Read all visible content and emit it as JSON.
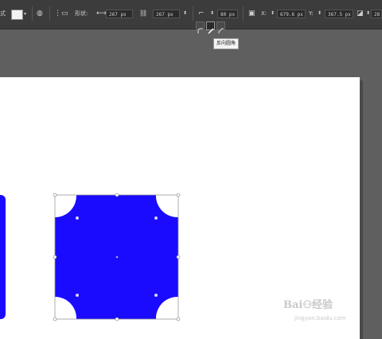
{
  "toolbar": {
    "shape_label": "形状:",
    "width_icon": "⟷",
    "width_value": "267 px",
    "link_icon": "🔗",
    "height_value": "267 px",
    "radius_icon": "⌐",
    "radius_value": "80 px",
    "x_value": "679.6 px",
    "y_value": "367.5 px",
    "x_label": "X:",
    "y_label": "Y:",
    "rot_value": "28",
    "truncated_label": "式"
  },
  "corner_types": {
    "items": [
      "round",
      "inverted-round",
      "chamfer"
    ],
    "selected_index": 1
  },
  "tooltip": {
    "text": "反向圆角"
  },
  "canvas": {
    "shape_fill": "#1a0bff",
    "page_color": "#ffffff",
    "workspace_color": "#5f5f5f"
  }
}
